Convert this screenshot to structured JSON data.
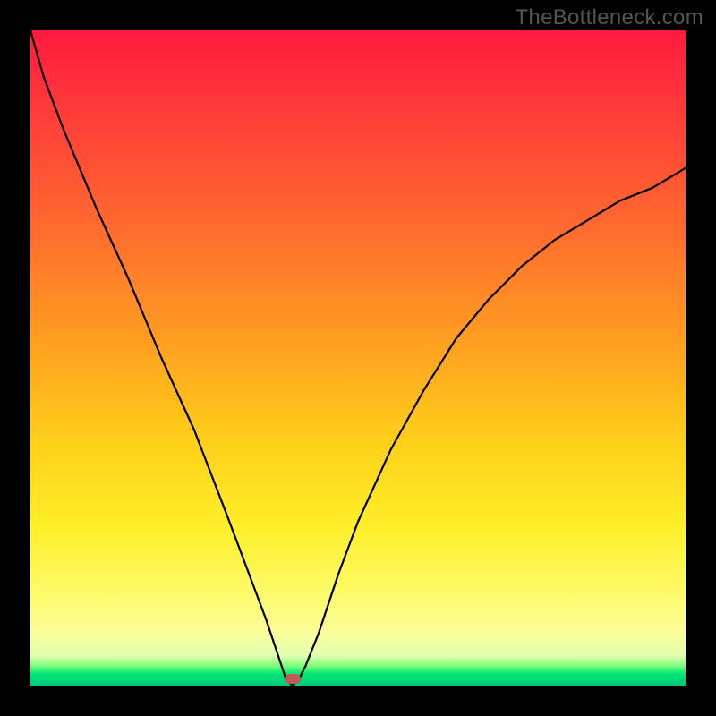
{
  "watermark": "TheBottleneck.com",
  "chart_data": {
    "type": "line",
    "title": "",
    "xlabel": "",
    "ylabel": "",
    "xlim": [
      0,
      100
    ],
    "ylim": [
      0,
      100
    ],
    "note": "Axes are unlabeled; values are relative (percent of plot dimension). Curve gives bottleneck severity (y) vs. hardware-balance parameter (x); bottom red marker indicates optimum near x≈40 where bottleneck ≈0.",
    "curve": {
      "name": "bottleneck-curve",
      "x": [
        0,
        2,
        5,
        10,
        15,
        20,
        25,
        30,
        33,
        36,
        38,
        39,
        40,
        41,
        42,
        44,
        47,
        50,
        55,
        60,
        65,
        70,
        75,
        80,
        85,
        90,
        95,
        100
      ],
      "y": [
        100,
        93,
        85,
        73,
        62,
        50,
        39,
        26,
        18,
        10,
        4,
        1,
        0,
        1,
        3,
        8,
        17,
        25,
        36,
        45,
        53,
        59,
        64,
        68,
        71,
        74,
        76,
        79
      ]
    },
    "background_gradient": {
      "direction": "top-to-bottom",
      "stops": [
        {
          "pos": 0.0,
          "color": "#ff1a3d"
        },
        {
          "pos": 0.12,
          "color": "#ff3a3a"
        },
        {
          "pos": 0.3,
          "color": "#ff6a2e"
        },
        {
          "pos": 0.48,
          "color": "#ffa020"
        },
        {
          "pos": 0.64,
          "color": "#ffd31a"
        },
        {
          "pos": 0.76,
          "color": "#ffef2a"
        },
        {
          "pos": 0.86,
          "color": "#fdfb6a"
        },
        {
          "pos": 0.92,
          "color": "#fbfd9a"
        },
        {
          "pos": 0.955,
          "color": "#e0ffb0"
        },
        {
          "pos": 0.97,
          "color": "#7bff7b"
        },
        {
          "pos": 0.982,
          "color": "#00e676"
        },
        {
          "pos": 1.0,
          "color": "#00c97a"
        }
      ]
    },
    "optimum_marker": {
      "x": 40,
      "y": 0,
      "color": "#c45a55"
    }
  }
}
